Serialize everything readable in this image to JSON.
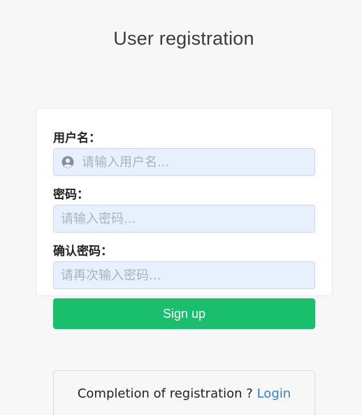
{
  "page": {
    "title": "User registration"
  },
  "form": {
    "username_label": "用户名：",
    "username_placeholder": "请输入用户名...",
    "password_label": "密码：",
    "password_placeholder": "请输入密码...",
    "confirm_label": "确认密码：",
    "confirm_placeholder": "请再次输入密码...",
    "submit_label": "Sign up"
  },
  "footer": {
    "prompt": "Completion of registration ? ",
    "login_link": "Login"
  },
  "icons": {
    "username_field_icon": "user-icon"
  },
  "colors": {
    "accent": "#1abf6e",
    "link": "#2f80d9",
    "input_bg": "#e8f0fe",
    "page_bg": "#f7f7f7"
  }
}
